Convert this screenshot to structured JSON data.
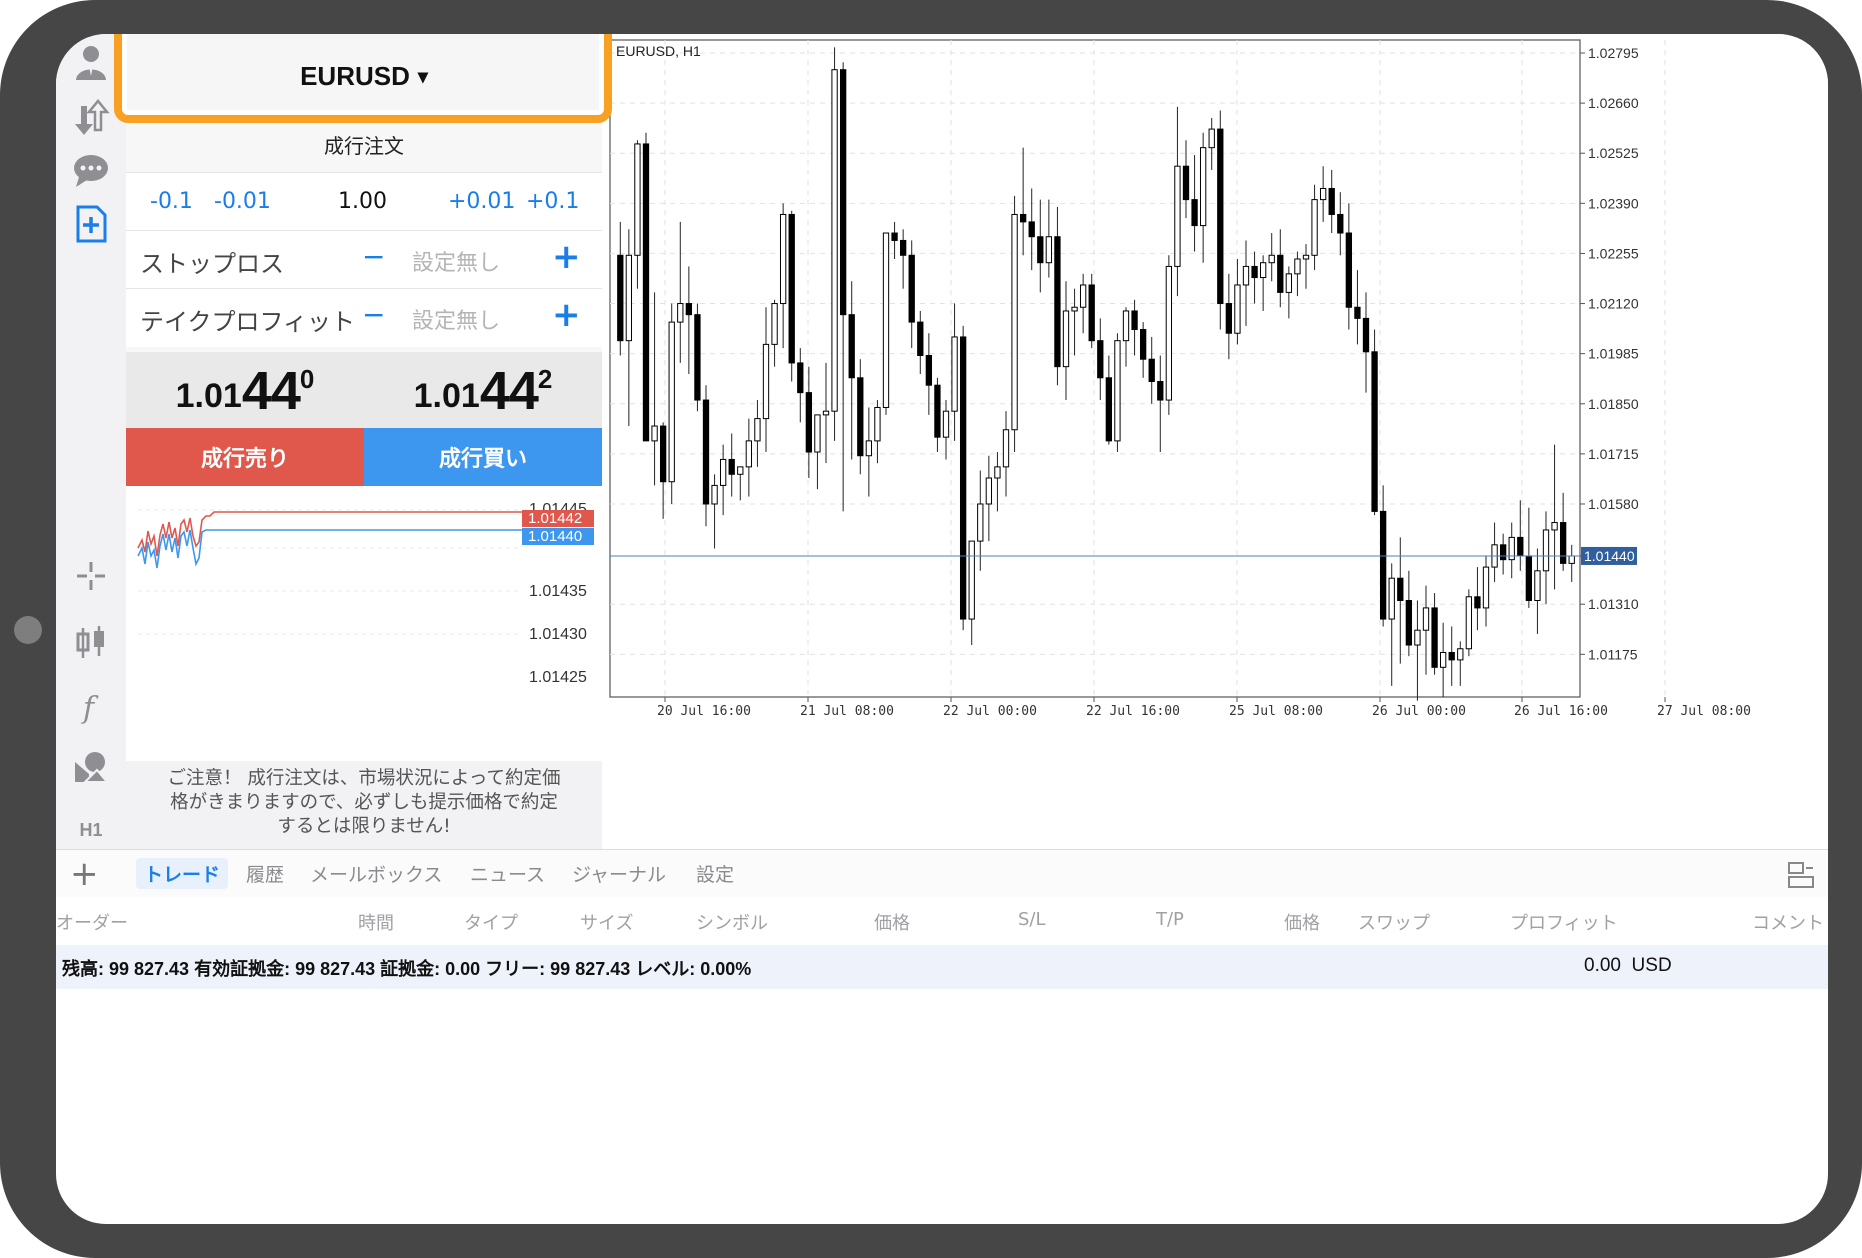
{
  "symbol": "EURUSD",
  "symbol_caret": "▾",
  "order": {
    "title": "成行注文",
    "volume_buttons": [
      "-0.1",
      "-0.01",
      "+0.01",
      "+0.1"
    ],
    "volume": "1.00",
    "stop_loss": {
      "label": "ストップロス",
      "value": "設定無し",
      "minus": "−",
      "plus": "+"
    },
    "take_profit": {
      "label": "テイクプロフィット",
      "value": "設定無し",
      "minus": "−",
      "plus": "+"
    },
    "bid": {
      "prefix": "1.01",
      "big": "44",
      "sup": "0"
    },
    "ask": {
      "prefix": "1.01",
      "big": "44",
      "sup": "2"
    },
    "sell_label": "成行売り",
    "buy_label": "成行買い",
    "notice": [
      "ご注意！ 成行注文は、市場状況によって約定価",
      "格がきまりますので、必ずしも提示価格で約定",
      "するとは限りません!"
    ]
  },
  "sidebar": {
    "timeframe": "H1"
  },
  "colors": {
    "sell": "#e0584c",
    "buy": "#3d97ef",
    "accent": "#1a7ee8",
    "highlight": "#f7a021"
  },
  "tick_chart": {
    "ticks": [
      "1.01445",
      "1.01440",
      "1.01435",
      "1.01430",
      "1.01425"
    ],
    "ask_label": "1.01442",
    "bid_label": "1.01440"
  },
  "chart_data": {
    "type": "candlestick",
    "title": "EURUSD, H1",
    "y_ticks": [
      "1.02795",
      "1.02660",
      "1.02525",
      "1.02390",
      "1.02255",
      "1.02120",
      "1.01985",
      "1.01850",
      "1.01715",
      "1.01580",
      "1.01440",
      "1.01310",
      "1.01175"
    ],
    "x_ticks": [
      "20 Jul 16:00",
      "21 Jul 08:00",
      "22 Jul 00:00",
      "22 Jul 16:00",
      "25 Jul 08:00",
      "26 Jul 00:00",
      "26 Jul 16:00",
      "27 Jul 08:00"
    ],
    "current_price": "1.01440",
    "ylim": [
      1.0106,
      1.0283
    ],
    "candles": [
      [
        1.0225,
        1.0234,
        1.0198,
        1.0202
      ],
      [
        1.0202,
        1.0232,
        1.0179,
        1.0225
      ],
      [
        1.0225,
        1.0256,
        1.0216,
        1.0255
      ],
      [
        1.0255,
        1.0258,
        1.0175,
        1.0175
      ],
      [
        1.0175,
        1.0215,
        1.0163,
        1.0179
      ],
      [
        1.0179,
        1.018,
        1.0154,
        1.0164
      ],
      [
        1.0164,
        1.0212,
        1.0158,
        1.0207
      ],
      [
        1.0207,
        1.0234,
        1.0196,
        1.0212
      ],
      [
        1.0212,
        1.0222,
        1.0193,
        1.0209
      ],
      [
        1.0209,
        1.0212,
        1.0183,
        1.0186
      ],
      [
        1.0186,
        1.019,
        1.0152,
        1.0158
      ],
      [
        1.0158,
        1.0166,
        1.0146,
        1.0163
      ],
      [
        1.0163,
        1.0174,
        1.0155,
        1.017
      ],
      [
        1.017,
        1.0177,
        1.016,
        1.0166
      ],
      [
        1.0166,
        1.0168,
        1.0159,
        1.0168
      ],
      [
        1.0168,
        1.0181,
        1.016,
        1.0175
      ],
      [
        1.0175,
        1.0186,
        1.0168,
        1.0181
      ],
      [
        1.0181,
        1.0211,
        1.0172,
        1.0201
      ],
      [
        1.0201,
        1.0213,
        1.0195,
        1.0212
      ],
      [
        1.0212,
        1.0239,
        1.02,
        1.0236
      ],
      [
        1.0236,
        1.0237,
        1.0191,
        1.0196
      ],
      [
        1.0196,
        1.02,
        1.018,
        1.0188
      ],
      [
        1.0188,
        1.0195,
        1.0165,
        1.0172
      ],
      [
        1.0172,
        1.0181,
        1.0162,
        1.0182
      ],
      [
        1.0182,
        1.0196,
        1.0169,
        1.0183
      ],
      [
        1.0183,
        1.0281,
        1.0175,
        1.0275
      ],
      [
        1.0275,
        1.0277,
        1.0156,
        1.0209
      ],
      [
        1.0209,
        1.0218,
        1.017,
        1.0192
      ],
      [
        1.0192,
        1.0197,
        1.0166,
        1.0171
      ],
      [
        1.0171,
        1.0184,
        1.016,
        1.0175
      ],
      [
        1.0175,
        1.0186,
        1.0169,
        1.0184
      ],
      [
        1.0184,
        1.0215,
        1.0182,
        1.0231
      ],
      [
        1.0231,
        1.0234,
        1.0224,
        1.0229
      ],
      [
        1.0229,
        1.0232,
        1.0216,
        1.0225
      ],
      [
        1.0225,
        1.0229,
        1.02,
        1.0207
      ],
      [
        1.0207,
        1.021,
        1.0193,
        1.0198
      ],
      [
        1.0198,
        1.0204,
        1.0182,
        1.019
      ],
      [
        1.019,
        1.0192,
        1.0172,
        1.0176
      ],
      [
        1.0176,
        1.0186,
        1.017,
        1.0183
      ],
      [
        1.0183,
        1.0212,
        1.0175,
        1.0203
      ],
      [
        1.0203,
        1.0206,
        1.0124,
        1.0127
      ],
      [
        1.0127,
        1.0148,
        1.012,
        1.0148
      ],
      [
        1.0148,
        1.0167,
        1.014,
        1.0158
      ],
      [
        1.0158,
        1.0171,
        1.0148,
        1.0165
      ],
      [
        1.0165,
        1.0172,
        1.0156,
        1.0168
      ],
      [
        1.0168,
        1.0183,
        1.016,
        1.0178
      ],
      [
        1.0178,
        1.0241,
        1.0172,
        1.0236
      ],
      [
        1.0236,
        1.0254,
        1.0225,
        1.0234
      ],
      [
        1.0234,
        1.0243,
        1.0221,
        1.023
      ],
      [
        1.023,
        1.024,
        1.0215,
        1.0223
      ],
      [
        1.0223,
        1.024,
        1.0219,
        1.023
      ],
      [
        1.023,
        1.0238,
        1.019,
        1.0195
      ],
      [
        1.0195,
        1.0218,
        1.0186,
        1.021
      ],
      [
        1.021,
        1.0216,
        1.0198,
        1.0211
      ],
      [
        1.0211,
        1.022,
        1.0204,
        1.0217
      ],
      [
        1.0217,
        1.022,
        1.02,
        1.0202
      ],
      [
        1.0202,
        1.0208,
        1.0186,
        1.0192
      ],
      [
        1.0192,
        1.0198,
        1.0174,
        1.0175
      ],
      [
        1.0175,
        1.0204,
        1.0172,
        1.0202
      ],
      [
        1.0202,
        1.0211,
        1.0195,
        1.021
      ],
      [
        1.021,
        1.0213,
        1.0198,
        1.0205
      ],
      [
        1.0205,
        1.0207,
        1.0192,
        1.0197
      ],
      [
        1.0197,
        1.0203,
        1.0185,
        1.0191
      ],
      [
        1.0191,
        1.0198,
        1.0172,
        1.0186
      ],
      [
        1.0186,
        1.0225,
        1.0182,
        1.0222
      ],
      [
        1.0222,
        1.0265,
        1.0214,
        1.0249
      ],
      [
        1.0249,
        1.0256,
        1.0235,
        1.024
      ],
      [
        1.024,
        1.0252,
        1.0226,
        1.0233
      ],
      [
        1.0233,
        1.0258,
        1.0223,
        1.0254
      ],
      [
        1.0254,
        1.0262,
        1.0248,
        1.0259
      ],
      [
        1.0259,
        1.0264,
        1.0205,
        1.0212
      ],
      [
        1.0212,
        1.022,
        1.0197,
        1.0204
      ],
      [
        1.0204,
        1.0224,
        1.0201,
        1.0217
      ],
      [
        1.0217,
        1.0229,
        1.0206,
        1.0222
      ],
      [
        1.0222,
        1.0226,
        1.0212,
        1.0219
      ],
      [
        1.0219,
        1.0225,
        1.021,
        1.0223
      ],
      [
        1.0223,
        1.0231,
        1.0218,
        1.0225
      ],
      [
        1.0225,
        1.0232,
        1.0211,
        1.0215
      ],
      [
        1.0215,
        1.0222,
        1.0208,
        1.022
      ],
      [
        1.022,
        1.0226,
        1.0214,
        1.0224
      ],
      [
        1.0224,
        1.0228,
        1.0216,
        1.0225
      ],
      [
        1.0225,
        1.0244,
        1.0221,
        1.024
      ],
      [
        1.024,
        1.0249,
        1.0234,
        1.0243
      ],
      [
        1.0243,
        1.0248,
        1.0231,
        1.0236
      ],
      [
        1.0236,
        1.0242,
        1.0225,
        1.0231
      ],
      [
        1.0231,
        1.0239,
        1.0205,
        1.0211
      ],
      [
        1.0211,
        1.0221,
        1.0201,
        1.0208
      ],
      [
        1.0208,
        1.0215,
        1.0188,
        1.0199
      ],
      [
        1.0199,
        1.0205,
        1.0155,
        1.0156
      ],
      [
        1.0156,
        1.0163,
        1.0125,
        1.0127
      ],
      [
        1.0127,
        1.0142,
        1.0109,
        1.0138
      ],
      [
        1.0138,
        1.0149,
        1.0115,
        1.0132
      ],
      [
        1.0132,
        1.014,
        1.0117,
        1.012
      ],
      [
        1.012,
        1.0132,
        1.0105,
        1.0124
      ],
      [
        1.0124,
        1.0136,
        1.0112,
        1.013
      ],
      [
        1.013,
        1.0134,
        1.0112,
        1.0114
      ],
      [
        1.0114,
        1.0126,
        1.0106,
        1.0118
      ],
      [
        1.0118,
        1.0125,
        1.0109,
        1.0116
      ],
      [
        1.0116,
        1.0121,
        1.0109,
        1.0119
      ],
      [
        1.0119,
        1.0135,
        1.0117,
        1.0133
      ],
      [
        1.0133,
        1.0141,
        1.0124,
        1.013
      ],
      [
        1.013,
        1.0144,
        1.0125,
        1.0141
      ],
      [
        1.0141,
        1.0153,
        1.0137,
        1.0147
      ],
      [
        1.0147,
        1.015,
        1.0139,
        1.0143
      ],
      [
        1.0143,
        1.0153,
        1.0138,
        1.0149
      ],
      [
        1.0149,
        1.0159,
        1.014,
        1.0144
      ],
      [
        1.0144,
        1.0157,
        1.013,
        1.0132
      ],
      [
        1.0132,
        1.0146,
        1.0123,
        1.014
      ],
      [
        1.014,
        1.0156,
        1.0131,
        1.0151
      ],
      [
        1.0151,
        1.0174,
        1.0135,
        1.0153
      ],
      [
        1.0153,
        1.0161,
        1.014,
        1.0142
      ],
      [
        1.0142,
        1.0147,
        1.0137,
        1.0144
      ]
    ]
  },
  "tabs": [
    "トレード",
    "履歴",
    "メールボックス",
    "ニュース",
    "ジャーナル",
    "設定"
  ],
  "columns": [
    "オーダー",
    "時間",
    "タイプ",
    "サイズ",
    "シンボル",
    "価格",
    "S/L",
    "T/P",
    "価格",
    "スワップ",
    "プロフィット",
    "コメント"
  ],
  "summary": {
    "text": "残高: 99 827.43 有効証拠金: 99 827.43 証拠金: 0.00 フリー: 99 827.43 レベル: 0.00%",
    "profit": "0.00",
    "currency": "USD"
  }
}
